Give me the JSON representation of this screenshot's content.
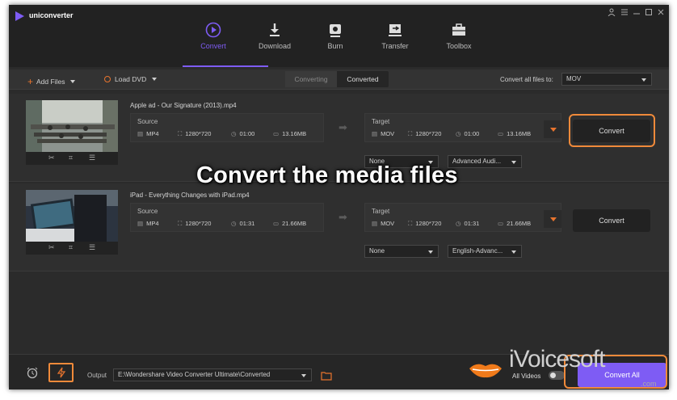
{
  "app": {
    "name": "uniconverter"
  },
  "window_controls": [
    "≤",
    "☰",
    "–",
    "☐",
    "✕"
  ],
  "nav": [
    {
      "label": "Convert",
      "icon": "convert-icon",
      "active": true
    },
    {
      "label": "Download",
      "icon": "download-icon",
      "active": false
    },
    {
      "label": "Burn",
      "icon": "burn-icon",
      "active": false
    },
    {
      "label": "Transfer",
      "icon": "transfer-icon",
      "active": false
    },
    {
      "label": "Toolbox",
      "icon": "toolbox-icon",
      "active": false
    }
  ],
  "toolbar": {
    "add_files": "Add Files",
    "load_dvd": "Load DVD",
    "tab_converting": "Converting",
    "tab_converted": "Converted",
    "convert_all_label": "Convert all files to:",
    "convert_all_value": "MOV"
  },
  "files": [
    {
      "name": "Apple ad - Our Signature (2013).mp4",
      "source_label": "Source",
      "source": {
        "format": "MP4",
        "resolution": "1280*720",
        "duration": "01:00",
        "size": "13.16MB"
      },
      "target_label": "Target",
      "target": {
        "format": "MOV",
        "resolution": "1280*720",
        "duration": "01:00",
        "size": "13.16MB"
      },
      "subtitle": "None",
      "audio": "Advanced Audi...",
      "convert_label": "Convert"
    },
    {
      "name": "iPad - Everything Changes with iPad.mp4",
      "source_label": "Source",
      "source": {
        "format": "MP4",
        "resolution": "1280*720",
        "duration": "01:31",
        "size": "21.66MB"
      },
      "target_label": "Target",
      "target": {
        "format": "MOV",
        "resolution": "1280*720",
        "duration": "01:31",
        "size": "21.66MB"
      },
      "subtitle": "None",
      "audio": "English-Advanc...",
      "convert_label": "Convert"
    }
  ],
  "caption": "Convert the media files",
  "footer": {
    "output_label": "Output",
    "output_path": "E:\\Wondershare Video Converter Ultimate\\Converted",
    "merge_label": "All Videos",
    "convert_all_button": "Convert All"
  },
  "watermark": {
    "text": "iVoicesoft",
    "suffix": ".com"
  },
  "colors": {
    "accent": "#7e5cf4",
    "highlight": "#f08a3a",
    "background": "#2b2b2b"
  }
}
